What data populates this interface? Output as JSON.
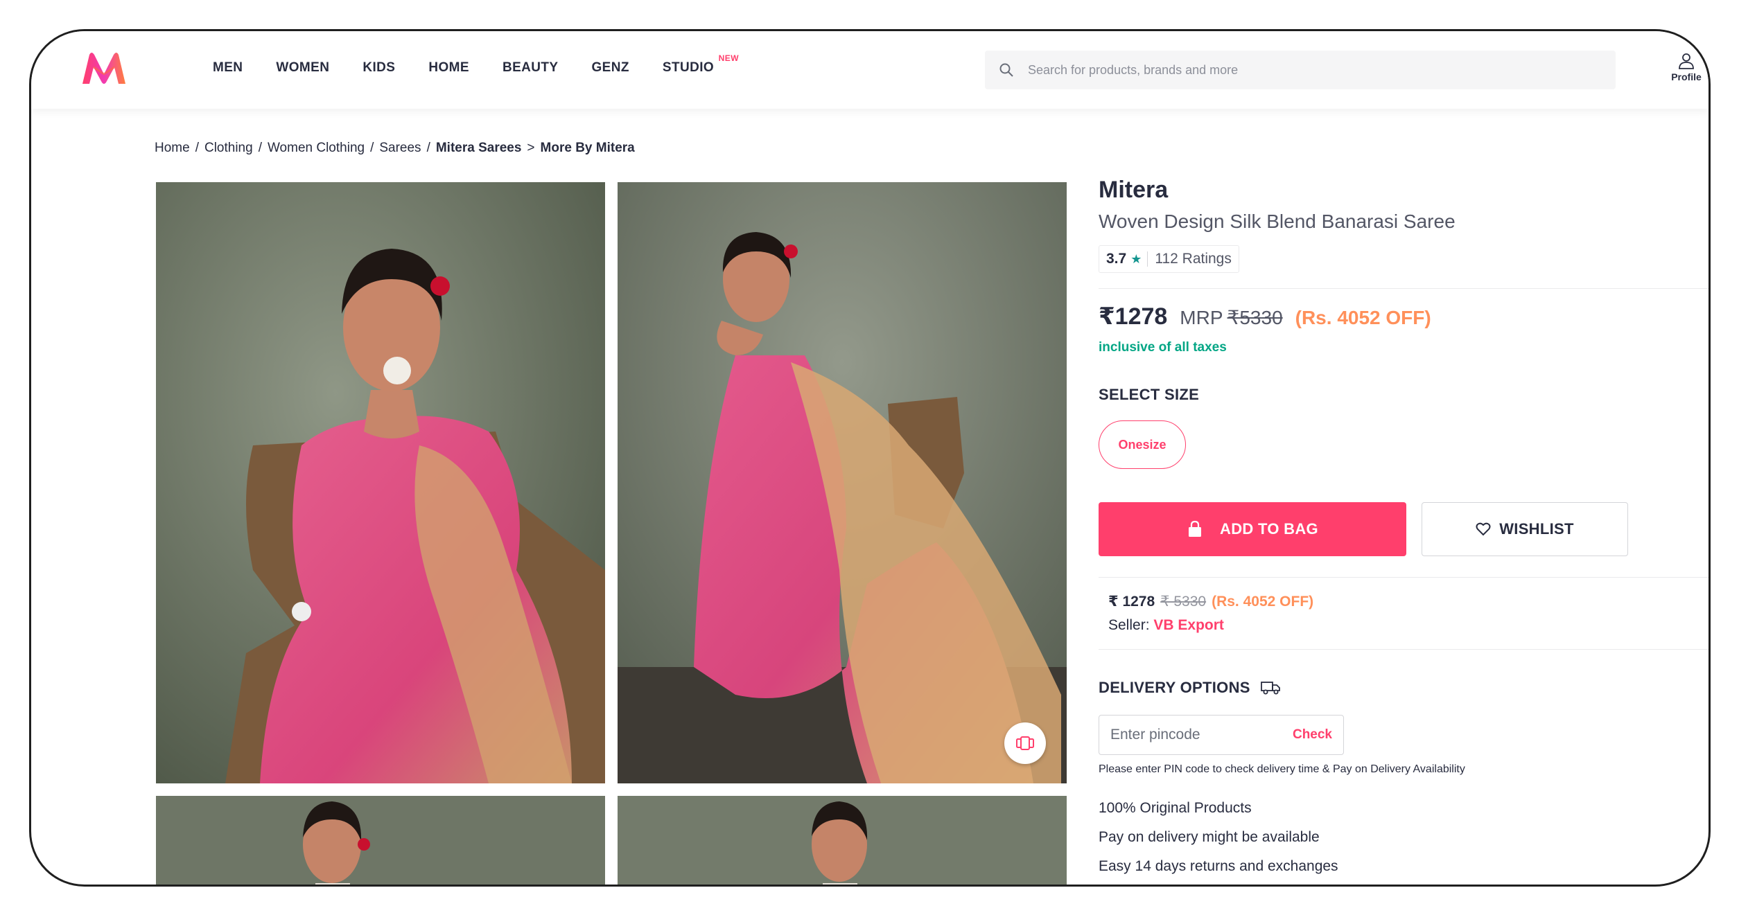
{
  "header": {
    "nav": [
      {
        "label": "MEN"
      },
      {
        "label": "WOMEN"
      },
      {
        "label": "KIDS"
      },
      {
        "label": "HOME"
      },
      {
        "label": "BEAUTY"
      },
      {
        "label": "GENZ"
      },
      {
        "label": "STUDIO",
        "tag": "NEW"
      }
    ],
    "search": {
      "placeholder": "Search for products, brands and more"
    },
    "profile_label": "Profile"
  },
  "breadcrumb": [
    {
      "label": "Home"
    },
    {
      "label": "Clothing"
    },
    {
      "label": "Women Clothing"
    },
    {
      "label": "Sarees"
    },
    {
      "label": "Mitera Sarees"
    },
    {
      "label": "More By Mitera"
    }
  ],
  "product": {
    "brand": "Mitera",
    "name": "Woven Design Silk Blend Banarasi Saree",
    "rating": "3.7",
    "rating_star": "★",
    "rating_count": "112 Ratings",
    "price": "₹1278",
    "mrp_label": "MRP",
    "mrp": "₹5330",
    "discount": "(Rs. 4052 OFF)",
    "tax_note": "inclusive of all taxes",
    "select_size_label": "SELECT SIZE",
    "sizes": [
      "Onesize"
    ],
    "add_to_bag_label": "ADD TO BAG",
    "wishlist_label": "WISHLIST"
  },
  "seller": {
    "price": "₹ 1278",
    "mrp": "₹ 5330",
    "discount": "(Rs. 4052 OFF)",
    "seller_label": "Seller:",
    "seller_name": "VB Export"
  },
  "delivery": {
    "title": "DELIVERY OPTIONS",
    "pincode_placeholder": "Enter pincode",
    "check_label": "Check",
    "note": "Please enter PIN code to check delivery time & Pay on Delivery Availability",
    "features": [
      "100% Original Products",
      "Pay on delivery might be available",
      "Easy 14 days returns and exchanges"
    ]
  },
  "colors": {
    "brand_pink": "#ff3f6c",
    "discount_orange": "#ff905a",
    "rating_teal": "#14958f",
    "tax_green": "#03a685"
  }
}
